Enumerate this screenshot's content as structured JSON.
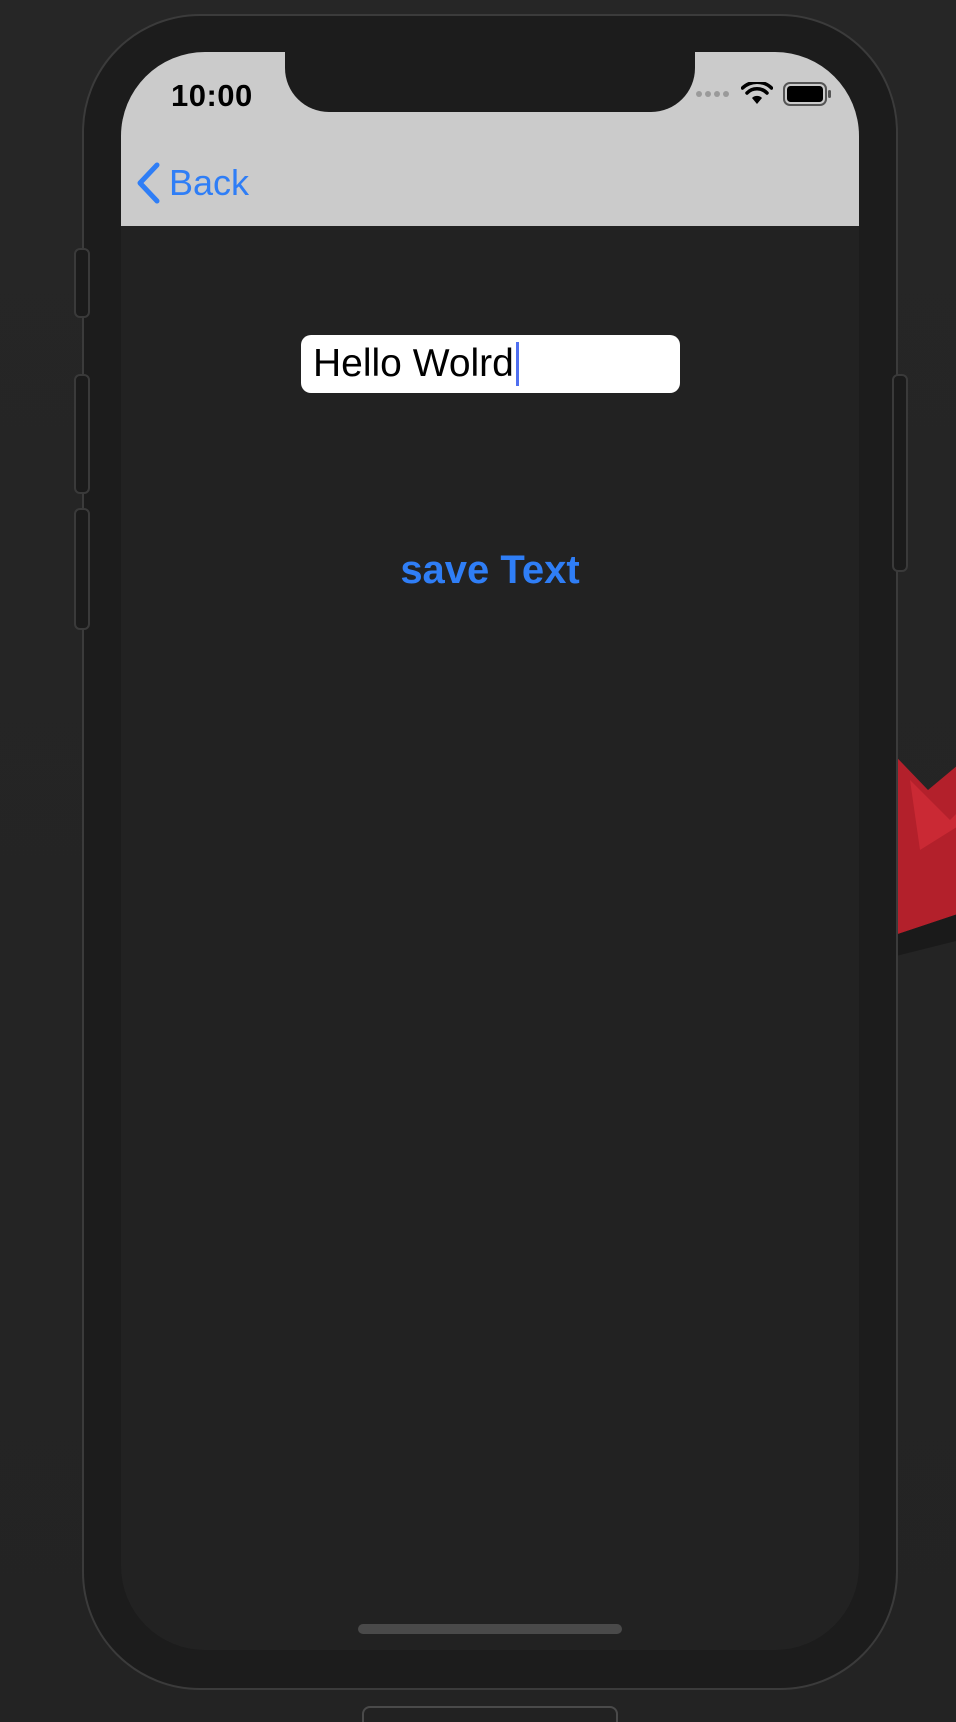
{
  "status_bar": {
    "time": "10:00"
  },
  "nav": {
    "back_label": "Back"
  },
  "form": {
    "text_value": "Hello Wolrd"
  },
  "actions": {
    "save_label": "save Text"
  },
  "colors": {
    "accent": "#2f7ef6",
    "screen_background": "#222222",
    "navbar_background": "#cbcbcb",
    "caret": "#4f6ff0"
  },
  "icons": {
    "back": "chevron-left-icon",
    "signal": "signal-dots-icon",
    "wifi": "wifi-icon",
    "battery": "battery-icon"
  }
}
